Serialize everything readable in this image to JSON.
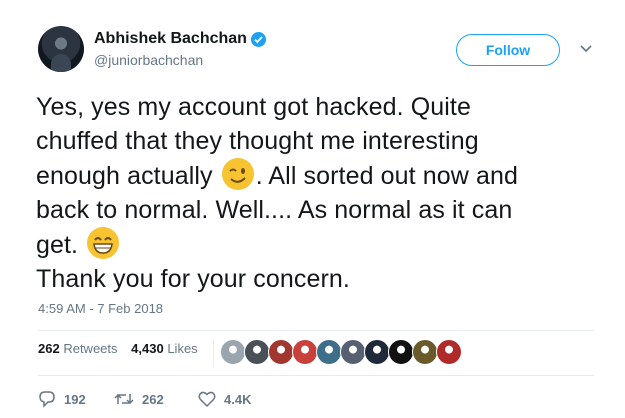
{
  "user": {
    "display_name": "Abhishek Bachchan",
    "handle": "@juniorbachchan",
    "verified": true,
    "accent_color": "#1da1f2"
  },
  "follow_button": {
    "label": "Follow"
  },
  "tweet": {
    "lines": [
      {
        "text_before": "Yes, yes my account got hacked. Quite"
      },
      {
        "text_before": "chuffed that they thought me interesting"
      },
      {
        "text_before": "enough actually ",
        "emoji": "winking-face-emoji",
        "text_after": ". All sorted out now and"
      },
      {
        "text_before": "back to normal. Well.... As normal as it can"
      },
      {
        "text_before": "get. ",
        "emoji": "grinning-face-emoji"
      },
      {
        "text_before": "Thank you for your concern."
      }
    ]
  },
  "timestamp": "4:59 AM - 7 Feb 2018",
  "stats": {
    "retweets_count": "262",
    "retweets_label": "Retweets",
    "likes_count": "4,430",
    "likes_label": "Likes"
  },
  "liker_avatar_colors": [
    "#9aa5ad",
    "#4a5058",
    "#a0362e",
    "#c9403a",
    "#3d6e8a",
    "#556070",
    "#1e2a3a",
    "#111111",
    "#6a5a2a",
    "#b02a2a"
  ],
  "actions": {
    "replies": "192",
    "retweets": "262",
    "likes": "4.4K"
  }
}
